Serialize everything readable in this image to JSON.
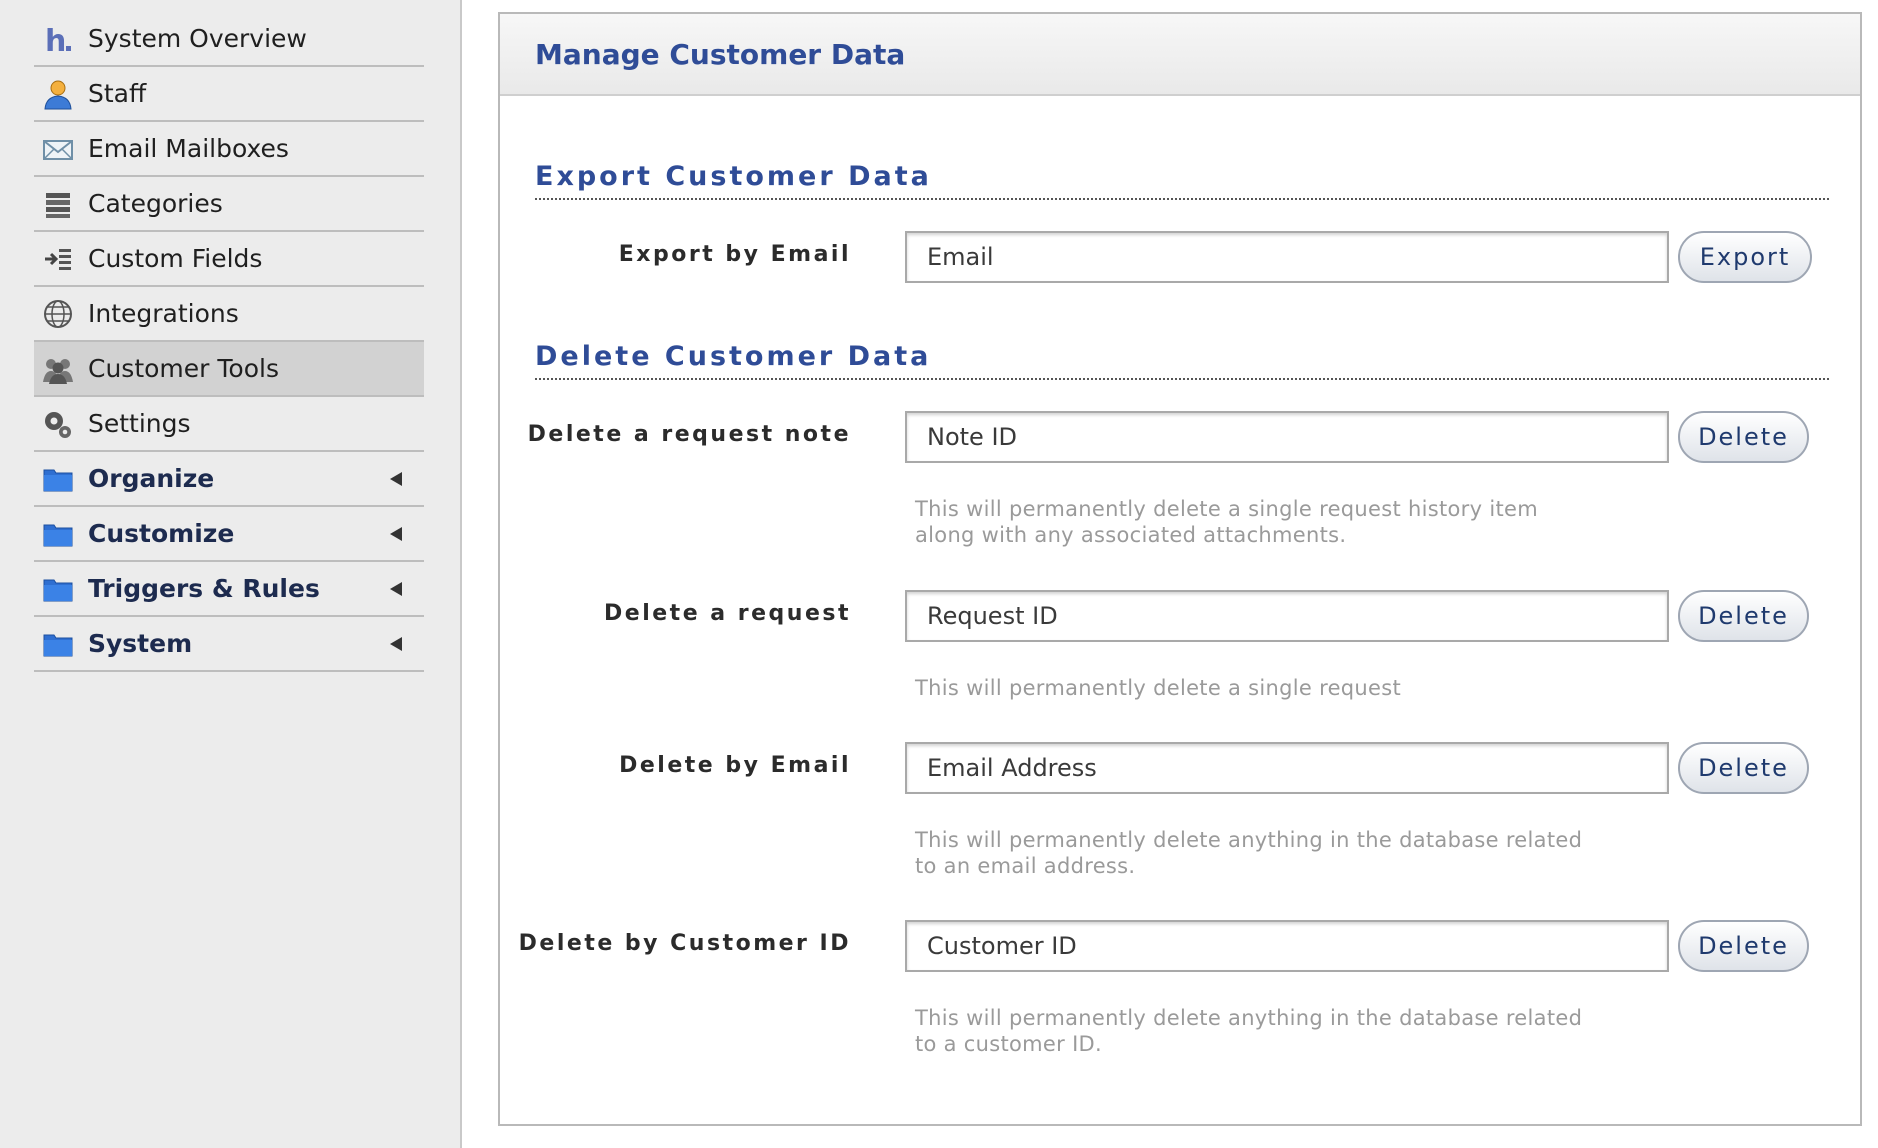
{
  "sidebar": {
    "items": [
      {
        "label": "System Overview",
        "icon": "helpdesk-logo-icon"
      },
      {
        "label": "Staff",
        "icon": "staff-icon"
      },
      {
        "label": "Email Mailboxes",
        "icon": "envelope-icon"
      },
      {
        "label": "Categories",
        "icon": "list-icon"
      },
      {
        "label": "Custom Fields",
        "icon": "custom-fields-icon"
      },
      {
        "label": "Integrations",
        "icon": "globe-icon"
      },
      {
        "label": "Customer Tools",
        "icon": "customer-tools-icon",
        "active": true
      },
      {
        "label": "Settings",
        "icon": "gears-icon"
      },
      {
        "label": "Organize",
        "icon": "folder-icon"
      },
      {
        "label": "Customize",
        "icon": "folder-icon"
      },
      {
        "label": "Triggers & Rules",
        "icon": "folder-icon"
      },
      {
        "label": "System",
        "icon": "folder-icon"
      }
    ]
  },
  "panel": {
    "title": "Manage Customer Data",
    "export": {
      "title": "Export Customer Data",
      "label": "Export by Email",
      "placeholder": "Email",
      "button": "Export"
    },
    "delete": {
      "title": "Delete Customer Data",
      "rows": [
        {
          "label": "Delete a request note",
          "placeholder": "Note ID",
          "button": "Delete",
          "hint": "This will permanently delete a single request history item\nalong with any associated attachments."
        },
        {
          "label": "Delete a request",
          "placeholder": "Request ID",
          "button": "Delete",
          "hint": "This will permanently delete a single request"
        },
        {
          "label": "Delete by Email",
          "placeholder": "Email Address",
          "button": "Delete",
          "hint": "This will permanently delete anything in the database related\nto an email address."
        },
        {
          "label": "Delete by Customer ID",
          "placeholder": "Customer ID",
          "button": "Delete",
          "hint": "This will permanently delete anything in the database related\nto a customer ID."
        }
      ]
    }
  },
  "colors": {
    "title_blue": "#2f4c97",
    "folder_blue": "#2f6fd1",
    "nav_group_text": "#1d2b4f",
    "hint_gray": "#9a9a9a"
  }
}
